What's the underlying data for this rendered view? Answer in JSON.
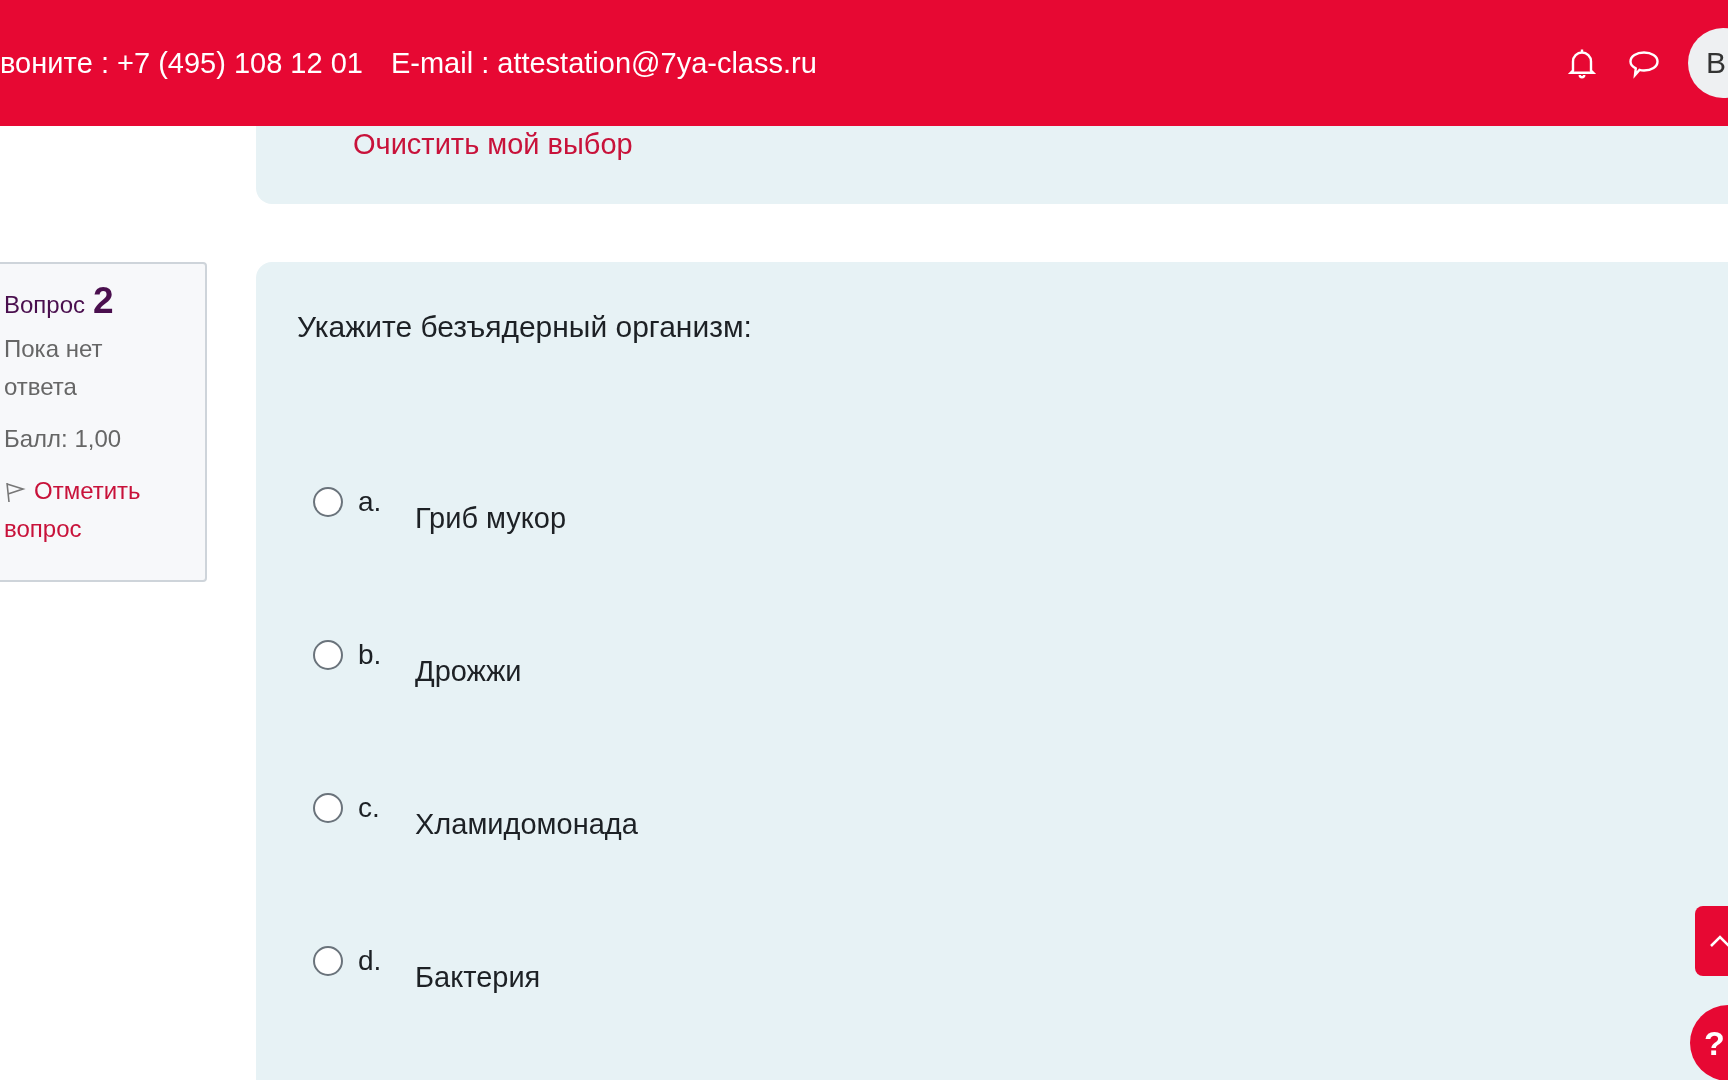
{
  "header": {
    "phone": "вонитe : +7 (495) 108 12 01",
    "email": "E-mail : attestation@7ya-class.ru",
    "avatar": "В"
  },
  "previous_question": {
    "clear_link": "Очистить мой выбор"
  },
  "question_info": {
    "label": "Вопрос",
    "number": "2",
    "status": "Пока нет ответа",
    "score": "Балл: 1,00",
    "flag_link": "Отметить вопрос"
  },
  "question": {
    "text": "Укажите безъядерный организм:",
    "options": [
      {
        "letter": "a.",
        "text": "Гриб мукор",
        "selected": false
      },
      {
        "letter": "b.",
        "text": "Дрожжи",
        "selected": false
      },
      {
        "letter": "c.",
        "text": "Хламидомонада",
        "selected": false
      },
      {
        "letter": "d.",
        "text": "Бактерия",
        "selected": false
      }
    ]
  },
  "floating": {
    "help": "?"
  }
}
